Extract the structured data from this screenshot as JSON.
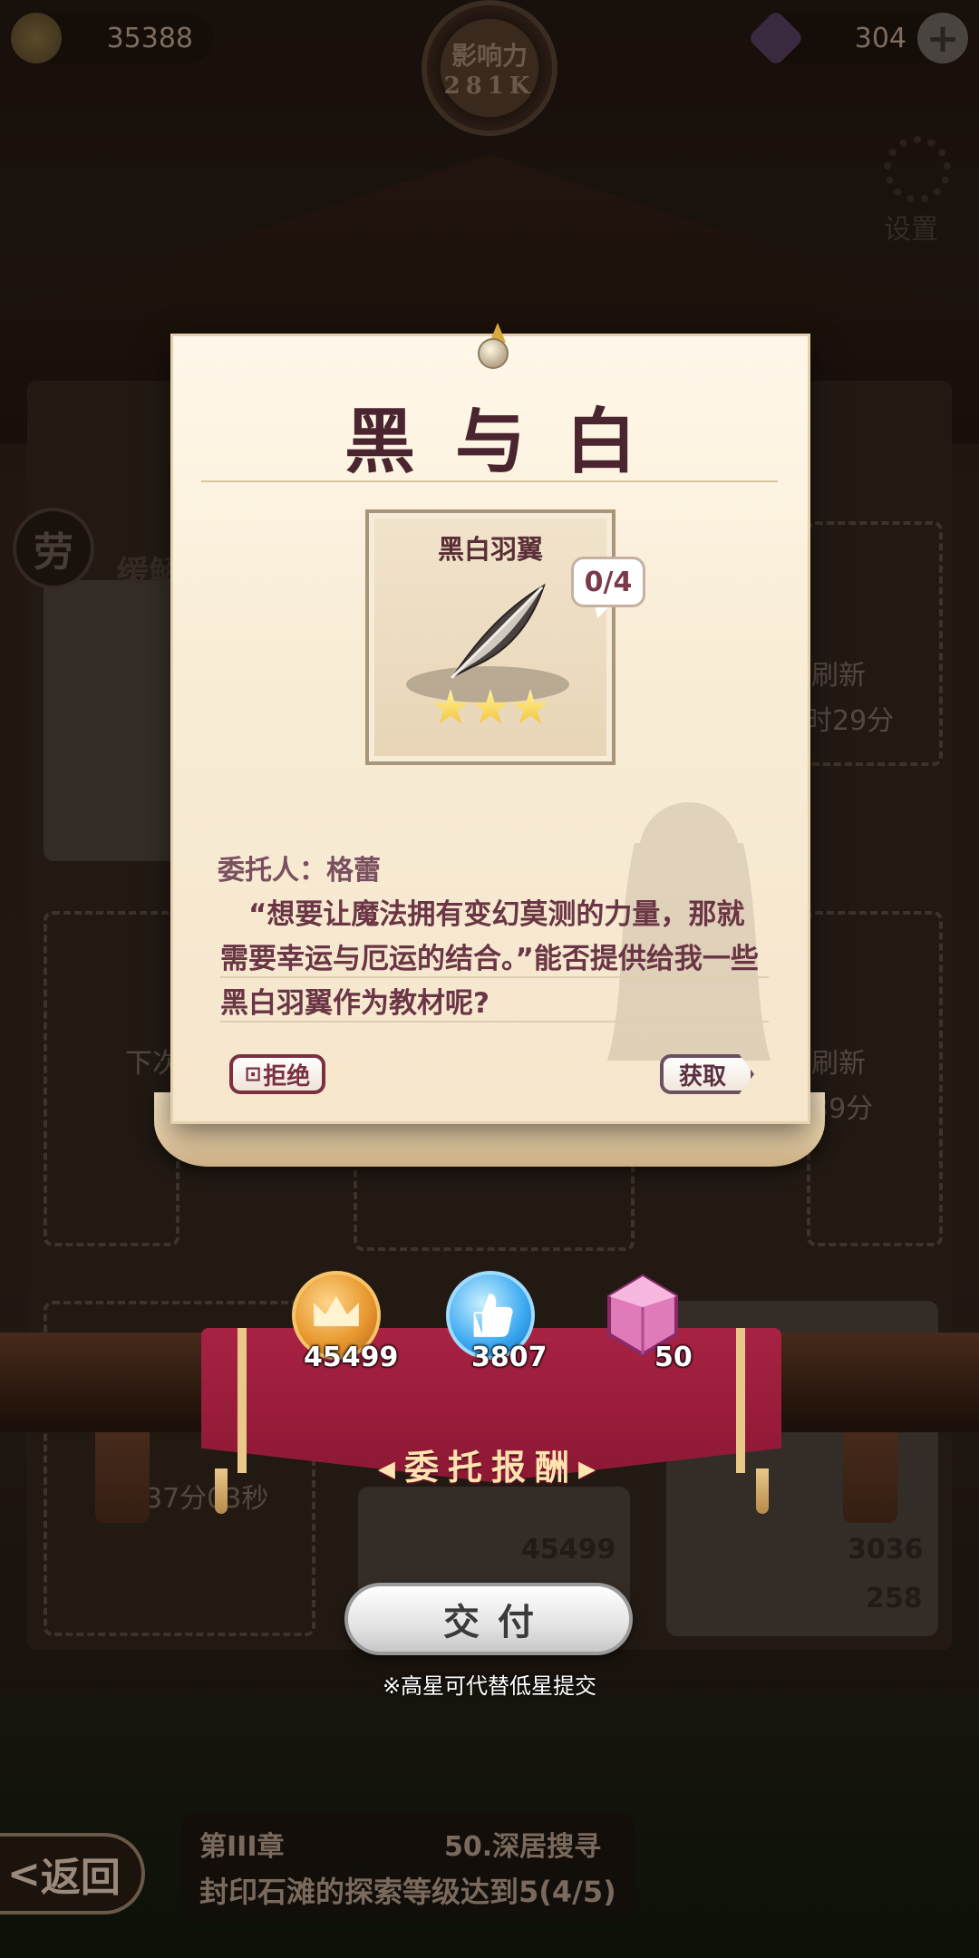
{
  "hud": {
    "gold": "35388",
    "gems": "304",
    "influence_label": "影响力",
    "influence_value": "281K"
  },
  "background": {
    "left_card_title": "缓解",
    "labor_tag": "劳",
    "refresh_1": "刷新",
    "timer_1": "时29分",
    "refresh_2": "刷新",
    "timer_2": "39分",
    "next_label": "下次",
    "timer_left": "37分03秒",
    "card_value_1": "45499",
    "card_value_2": "3036",
    "card_value_3": "258",
    "settings_label": "设置"
  },
  "dialog": {
    "title": "黑与白",
    "item_name": "黑白羽翼",
    "item_count": "0/4",
    "item_stars": 3,
    "client": "委托人：格蕾",
    "quote": "　“想要让魔法拥有变幻莫测的力量，那就需要幸运与厄运的结合。”能否提供给我一些黑白羽翼作为教材呢?",
    "refuse_label": "拒绝",
    "get_label": "获取"
  },
  "rewards": {
    "banner_label": "◂委托报酬▸",
    "items": [
      {
        "icon": "gold-crown-coin-icon",
        "value": "45499"
      },
      {
        "icon": "thumbs-up-orb-icon",
        "value": "3807"
      },
      {
        "icon": "pink-gem-icon",
        "value": "50"
      }
    ]
  },
  "submit_label": "交付",
  "note": "※高星可代替低星提交",
  "bottom": {
    "back_label": "返回",
    "chapter": "第III章",
    "quest_name": "50.深居搜寻",
    "quest_desc": "封印石滩的探索等级达到5(4/5)"
  },
  "colors": {
    "banner": "#a82243",
    "title": "#4a2530",
    "paper": "#f9edd6"
  }
}
